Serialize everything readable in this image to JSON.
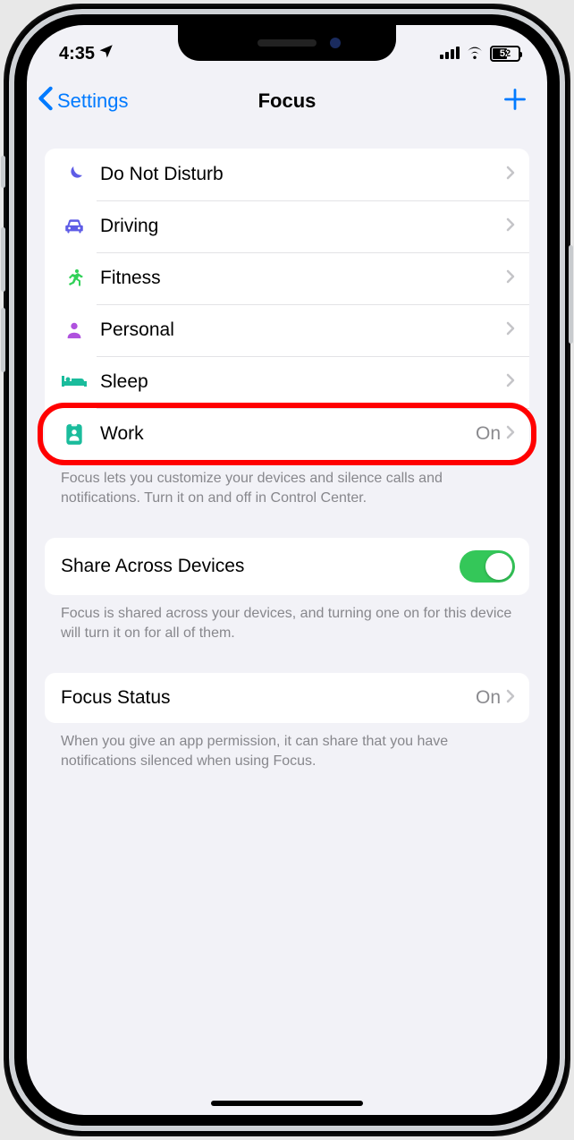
{
  "status": {
    "time": "4:35",
    "battery": "52"
  },
  "nav": {
    "back_label": "Settings",
    "title": "Focus"
  },
  "focus_modes": {
    "items": [
      {
        "label": "Do Not Disturb",
        "icon": "moon",
        "color": "#5e5ce6",
        "value": ""
      },
      {
        "label": "Driving",
        "icon": "car",
        "color": "#5e5ce6",
        "value": ""
      },
      {
        "label": "Fitness",
        "icon": "runner",
        "color": "#31d158",
        "value": ""
      },
      {
        "label": "Personal",
        "icon": "person",
        "color": "#af52de",
        "value": ""
      },
      {
        "label": "Sleep",
        "icon": "bed",
        "color": "#1abc9c",
        "value": ""
      },
      {
        "label": "Work",
        "icon": "badge",
        "color": "#1abc9c",
        "value": "On"
      }
    ],
    "footer": "Focus lets you customize your devices and silence calls and notifications. Turn it on and off in Control Center."
  },
  "share": {
    "label": "Share Across Devices",
    "enabled": true,
    "footer": "Focus is shared across your devices, and turning one on for this device will turn it on for all of them."
  },
  "focus_status": {
    "label": "Focus Status",
    "value": "On",
    "footer": "When you give an app permission, it can share that you have notifications silenced when using Focus."
  },
  "annotation": {
    "highlighted_row_index": 5
  }
}
